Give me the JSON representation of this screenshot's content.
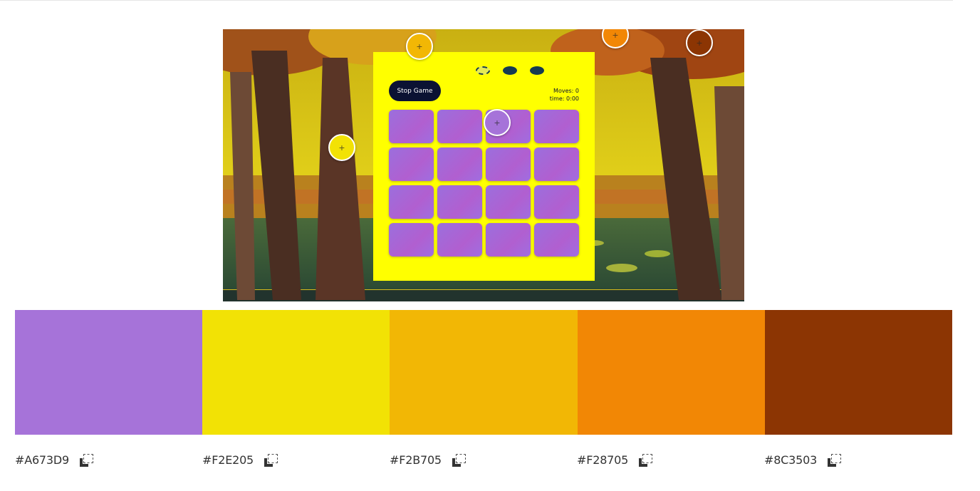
{
  "game": {
    "stop_label": "Stop Game",
    "moves_text": "Moves: 0",
    "time_text": "time: 0:00",
    "tile_count": 16
  },
  "handles": [
    {
      "color": "#F2B705",
      "name": "handle-amber"
    },
    {
      "color": "#F28705",
      "name": "handle-orange"
    },
    {
      "color": "#8C3503",
      "name": "handle-brown"
    },
    {
      "color": "#F2E205",
      "name": "handle-yellow"
    },
    {
      "color": "#A673D9",
      "name": "handle-purple"
    }
  ],
  "palette": [
    {
      "hex": "#A673D9"
    },
    {
      "hex": "#F2E205"
    },
    {
      "hex": "#F2B705"
    },
    {
      "hex": "#F28705"
    },
    {
      "hex": "#8C3503"
    }
  ],
  "icons": {
    "copy": "copy-icon",
    "handle_marker": "plus-icon"
  }
}
